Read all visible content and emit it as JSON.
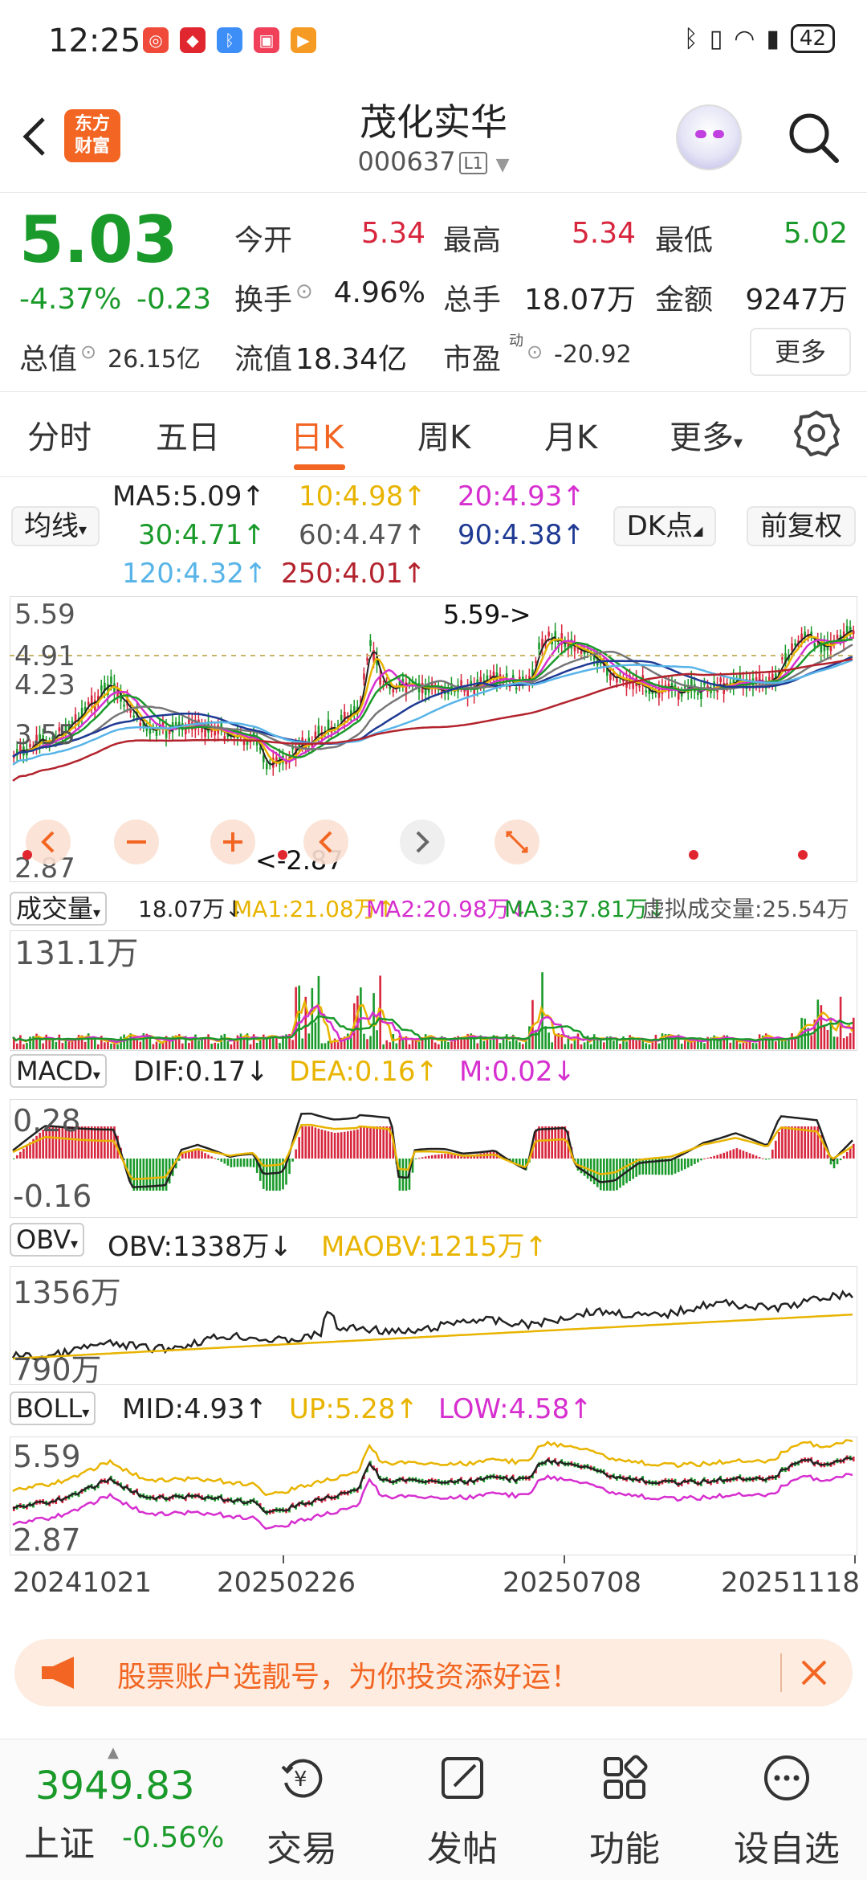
{
  "status_bar": {
    "time": "12:25",
    "battery": "42"
  },
  "header": {
    "back_icon": "chevron-left-icon",
    "logo_line1": "东方",
    "logo_line2": "财富",
    "stock_name": "茂化实华",
    "stock_code": "000637",
    "market_badge": "L1"
  },
  "quote": {
    "price": "5.03",
    "change_pct": "-4.37%",
    "change_abs": "-0.23",
    "open_label": "今开",
    "open": "5.34",
    "high_label": "最高",
    "high": "5.34",
    "low_label": "最低",
    "low": "5.02",
    "turnover_label": "换手",
    "turnover": "4.96%",
    "volume_label": "总手",
    "volume": "18.07万",
    "amount_label": "金额",
    "amount": "9247万",
    "total_cap_label": "总值",
    "total_cap": "26.15亿",
    "float_cap_label": "流值",
    "float_cap": "18.34亿",
    "pe_label": "市盈",
    "pe_sup": "动",
    "pe": "-20.92",
    "more_button": "更多"
  },
  "tabs": [
    "分时",
    "五日",
    "日K",
    "周K",
    "月K",
    "更多"
  ],
  "active_tab": "日K",
  "ma_legend": {
    "ma_button": "均线",
    "ma5": "MA5:5.09↑",
    "ma10": "10:4.98↑",
    "ma20": "20:4.93↑",
    "ma30": "30:4.71↑",
    "ma60": "60:4.47↑",
    "ma90": "90:4.38↑",
    "ma120": "120:4.32↑",
    "ma250": "250:4.01↑",
    "dk_button": "DK点",
    "adjust_button": "前复权"
  },
  "colors": {
    "up": "#d7263d",
    "down": "#1a9a2a",
    "accent": "#f26522",
    "ma5": "#222222",
    "ma10": "#e8b400",
    "ma20": "#d62fcf",
    "ma30": "#1a9a2a",
    "ma60": "#777777",
    "ma90": "#1f3a93",
    "ma120": "#58b4e8",
    "ma250": "#b3232d"
  },
  "kline": {
    "y_top": "5.59",
    "y_mid1": "4.91",
    "y_mid2": "4.23",
    "y_mid3": "3.55",
    "y_bottom": "2.87",
    "max_marker": "5.59->",
    "min_marker": "<-2.87"
  },
  "volume": {
    "button": "成交量",
    "value": "18.07万↓",
    "ma1": "MA1:21.08万↑",
    "ma2": "MA2:20.98万↓",
    "ma3": "MA3:37.81万↓",
    "virtual": "虚拟成交量:25.54万",
    "y_top": "131.1万"
  },
  "macd": {
    "button": "MACD",
    "dif": "DIF:0.17↓",
    "dea": "DEA:0.16↑",
    "m": "M:0.02↓",
    "y_top": "0.28",
    "y_bottom": "-0.16"
  },
  "obv": {
    "button": "OBV",
    "obv": "OBV:1338万↓",
    "maobv": "MAOBV:1215万↑",
    "y_top": "1356万",
    "y_bottom": "790万"
  },
  "boll": {
    "button": "BOLL",
    "mid": "MID:4.93↑",
    "up": "UP:5.28↑",
    "low": "LOW:4.58↑",
    "y_top": "5.59",
    "y_bottom": "2.87"
  },
  "x_dates": [
    "20241021",
    "20250226",
    "20250708",
    "20251118"
  ],
  "banner": {
    "text": "股票账户选靓号，为你投资添好运！"
  },
  "bottom_nav": {
    "index_value": "3949.83",
    "index_name": "上证",
    "index_change": "-0.56%",
    "items": [
      "交易",
      "发帖",
      "功能",
      "设自选"
    ]
  }
}
